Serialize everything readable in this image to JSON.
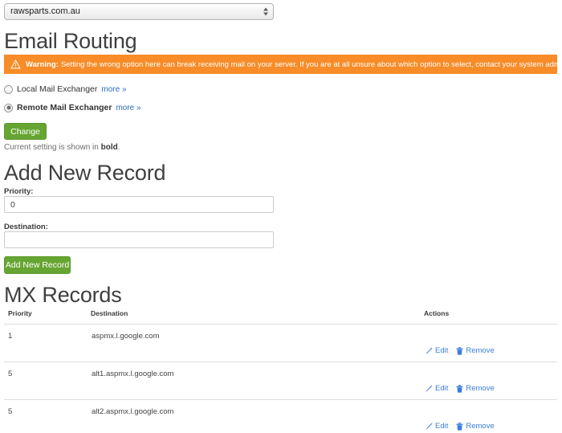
{
  "domain_selector": {
    "name": "domain-select",
    "selected": "rawsparts.com.au",
    "options": [
      "rawsparts.com.au"
    ]
  },
  "headings": {
    "email_routing": "Email Routing",
    "add_new_record": "Add New Record",
    "mx_records": "MX Records"
  },
  "warning": {
    "icon": "warning-triangle-icon",
    "strong": "Warning:",
    "text": "Setting the wrong option here can break receiving mail on your server. If you are at all unsure about which option to select, contact your system administrator.",
    "background_color": "#f78c28",
    "text_color": "#ffffff"
  },
  "routing_options": [
    {
      "label": "Local Mail Exchanger",
      "more_label": "more »",
      "checked": false,
      "bold": false
    },
    {
      "label": "Remote Mail Exchanger",
      "more_label": "more »",
      "checked": true,
      "bold": true
    }
  ],
  "change_button": {
    "label": "Change",
    "color": "#66a532"
  },
  "current_setting_note": {
    "prefix": "Current setting is shown in ",
    "emphasis": "bold",
    "suffix": "."
  },
  "add_record_form": {
    "priority_label": "Priority:",
    "priority_value": "0",
    "priority_placeholder": "",
    "destination_label": "Destination:",
    "destination_value": "",
    "destination_placeholder": "",
    "submit_label": "Add New Record",
    "submit_color": "#66a532"
  },
  "mx_table": {
    "columns": [
      "Priority",
      "Destination",
      "Actions"
    ],
    "rows": [
      {
        "priority": "1",
        "destination": "aspmx.l.google.com",
        "edit_label": "Edit",
        "remove_label": "Remove"
      },
      {
        "priority": "5",
        "destination": "alt1.aspmx.l.google.com",
        "edit_label": "Edit",
        "remove_label": "Remove"
      },
      {
        "priority": "5",
        "destination": "alt2.aspmx.l.google.com",
        "edit_label": "Edit",
        "remove_label": "Remove"
      }
    ],
    "action_link_color": "#3b7ddd",
    "edit_icon": "pencil-icon",
    "remove_icon": "trash-icon"
  }
}
